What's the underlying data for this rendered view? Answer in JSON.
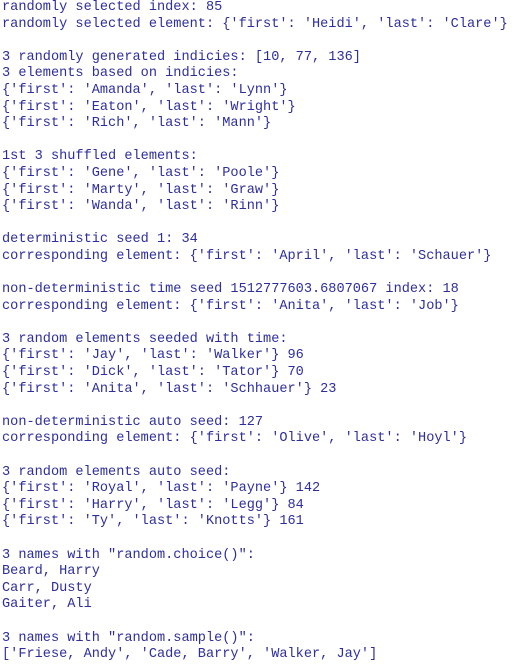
{
  "text_color": "#2e2e9e",
  "console": {
    "lines": [
      "randomly selected index: 85",
      "randomly selected element: {'first': 'Heidi', 'last': 'Clare'}",
      "",
      "3 randomly generated indicies: [10, 77, 136]",
      "3 elements based on indicies:",
      "{'first': 'Amanda', 'last': 'Lynn'}",
      "{'first': 'Eaton', 'last': 'Wright'}",
      "{'first': 'Rich', 'last': 'Mann'}",
      "",
      "1st 3 shuffled elements:",
      "{'first': 'Gene', 'last': 'Poole'}",
      "{'first': 'Marty', 'last': 'Graw'}",
      "{'first': 'Wanda', 'last': 'Rinn'}",
      "",
      "deterministic seed 1: 34",
      "corresponding element: {'first': 'April', 'last': 'Schauer'}",
      "",
      "non-deterministic time seed 1512777603.6807067 index: 18",
      "corresponding element: {'first': 'Anita', 'last': 'Job'}",
      "",
      "3 random elements seeded with time:",
      "{'first': 'Jay', 'last': 'Walker'} 96",
      "{'first': 'Dick', 'last': 'Tator'} 70",
      "{'first': 'Anita', 'last': 'Schhauer'} 23",
      "",
      "non-deterministic auto seed: 127",
      "corresponding element: {'first': 'Olive', 'last': 'Hoyl'}",
      "",
      "3 random elements auto seed:",
      "{'first': 'Royal', 'last': 'Payne'} 142",
      "{'first': 'Harry', 'last': 'Legg'} 84",
      "{'first': 'Ty', 'last': 'Knotts'} 161",
      "",
      "3 names with \"random.choice()\":",
      "Beard, Harry",
      "Carr, Dusty",
      "Gaiter, Ali",
      "",
      "3 names with \"random.sample()\":",
      "['Friese, Andy', 'Cade, Barry', 'Walker, Jay']"
    ]
  }
}
